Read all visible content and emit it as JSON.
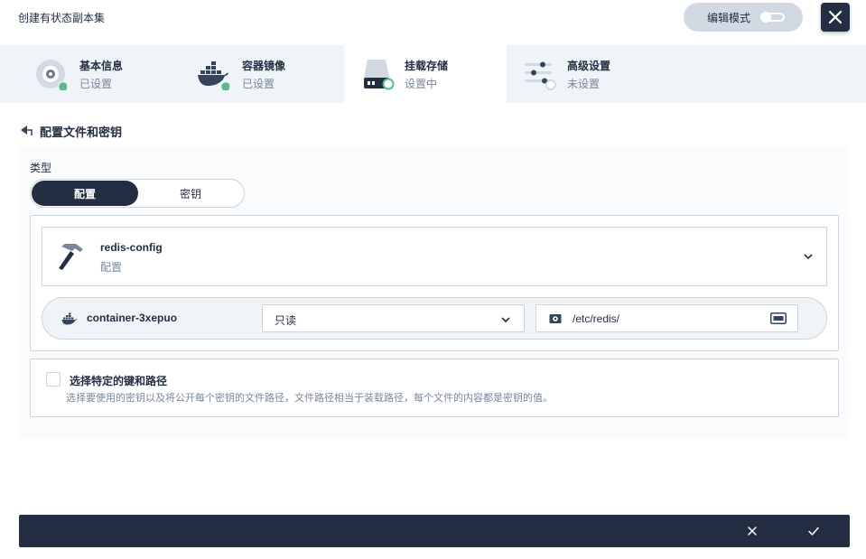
{
  "header": {
    "title": "创建有状态副本集",
    "edit_mode_label": "编辑模式"
  },
  "tabs": [
    {
      "title": "基本信息",
      "status": "已设置",
      "icon": "disc-icon",
      "state": "done"
    },
    {
      "title": "容器镜像",
      "status": "已设置",
      "icon": "docker-icon",
      "state": "done"
    },
    {
      "title": "挂载存储",
      "status": "设置中",
      "icon": "storage-icon",
      "state": "active"
    },
    {
      "title": "高级设置",
      "status": "未设置",
      "icon": "sliders-icon",
      "state": "pending"
    }
  ],
  "section": {
    "title": "配置文件和密钥"
  },
  "type_field": {
    "label": "类型",
    "options": [
      "配置",
      "密钥"
    ],
    "selected": "配置"
  },
  "config_select": {
    "name": "redis-config",
    "type": "配置"
  },
  "mount": {
    "container": "container-3xepuo",
    "mode": "只读",
    "path": "/etc/redis/"
  },
  "specific_keys": {
    "checked": false,
    "title": "选择特定的键和路径",
    "description": "选择要使用的密钥以及将公开每个密钥的文件路径，文件路径相当于装载路径，每个文件的内容都是密钥的值。"
  },
  "colors": {
    "primary": "#242e42",
    "success": "#55bc8a",
    "muted": "#79879c",
    "border": "#ccd3db",
    "tab_bg": "#eff4f9"
  }
}
